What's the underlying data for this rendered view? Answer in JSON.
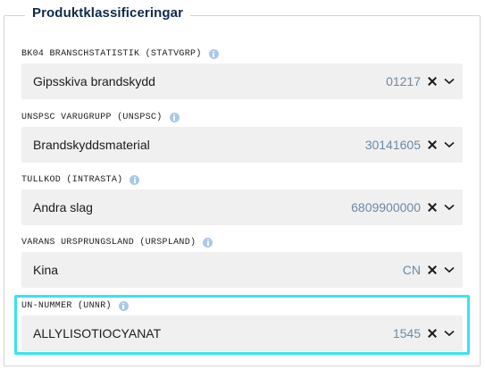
{
  "section": {
    "title": "Produktklassificeringar"
  },
  "fields": [
    {
      "label": "BK04 BRANSCHSTATISTIK (STATVGRP)",
      "value": "Gipsskiva brandskydd",
      "code": "01217"
    },
    {
      "label": "UNSPSC VARUGRUPP (UNSPSC)",
      "value": "Brandskyddsmaterial",
      "code": "30141605"
    },
    {
      "label": "TULLKOD (INTRASTA)",
      "value": "Andra slag",
      "code": "6809900000"
    },
    {
      "label": "VARANS URSPRUNGSLAND (URSPLAND)",
      "value": "Kina",
      "code": "CN"
    },
    {
      "label": "UN-NUMMER (UNNR)",
      "value": "ALLYLISOTIOCYANAT",
      "code": "1545"
    }
  ],
  "icons": {
    "info": "info-icon",
    "clear": "close-icon",
    "dropdown": "chevron-down-icon"
  },
  "colors": {
    "highlight": "#37e3f2",
    "info": "#a9c9ea",
    "code_text": "#6a8aa6",
    "field_bg": "#f0f0f0"
  }
}
